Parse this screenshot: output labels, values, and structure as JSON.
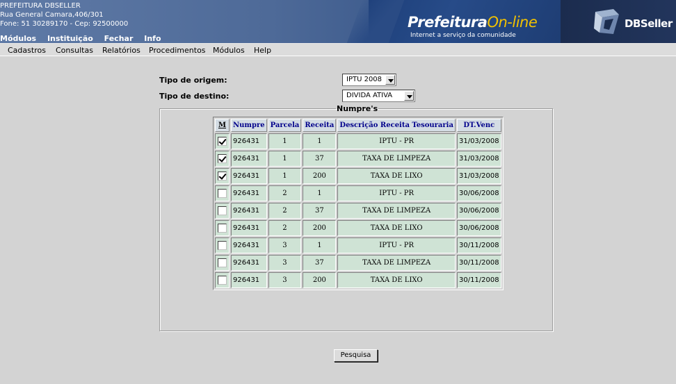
{
  "header": {
    "org_name": "PREFEITURA DBSELLER",
    "address": "Rua General Camara,406/301",
    "contact": "Fone: 51 30289170  -  Cep: 92500000",
    "top_menu": [
      "Módulos",
      "Instituição",
      "Fechar",
      "Info"
    ],
    "portal_title_main": "Prefeitura",
    "portal_title_accent": "On-line",
    "portal_subtitle": "Internet a serviço da comunidade",
    "vendor_logo": "DBSeller"
  },
  "menubar": [
    "Cadastros",
    "Consultas",
    "Relatórios",
    "Procedimentos",
    "Módulos",
    "Help"
  ],
  "form": {
    "origem_label": "Tipo de origem:",
    "origem_value": "IPTU 2008",
    "destino_label": "Tipo de destino:",
    "destino_value": "DIVIDA ATIVA",
    "fieldset_legend": "Numpre's"
  },
  "table": {
    "headers": [
      "M",
      "Numpre",
      "Parcela",
      "Receita",
      "Descrição Receita Tesouraria",
      "DT.Venc"
    ],
    "rows": [
      {
        "checked": true,
        "numpre": "926431",
        "parcela": "1",
        "receita": "1",
        "descricao": "IPTU - PR",
        "venc": "31/03/2008"
      },
      {
        "checked": true,
        "numpre": "926431",
        "parcela": "1",
        "receita": "37",
        "descricao": "TAXA DE LIMPEZA",
        "venc": "31/03/2008"
      },
      {
        "checked": true,
        "numpre": "926431",
        "parcela": "1",
        "receita": "200",
        "descricao": "TAXA DE LIXO",
        "venc": "31/03/2008"
      },
      {
        "checked": false,
        "numpre": "926431",
        "parcela": "2",
        "receita": "1",
        "descricao": "IPTU - PR",
        "venc": "30/06/2008"
      },
      {
        "checked": false,
        "numpre": "926431",
        "parcela": "2",
        "receita": "37",
        "descricao": "TAXA DE LIMPEZA",
        "venc": "30/06/2008"
      },
      {
        "checked": false,
        "numpre": "926431",
        "parcela": "2",
        "receita": "200",
        "descricao": "TAXA DE LIXO",
        "venc": "30/06/2008"
      },
      {
        "checked": false,
        "numpre": "926431",
        "parcela": "3",
        "receita": "1",
        "descricao": "IPTU - PR",
        "venc": "30/11/2008"
      },
      {
        "checked": false,
        "numpre": "926431",
        "parcela": "3",
        "receita": "37",
        "descricao": "TAXA DE LIMPEZA",
        "venc": "30/11/2008"
      },
      {
        "checked": false,
        "numpre": "926431",
        "parcela": "3",
        "receita": "200",
        "descricao": "TAXA DE LIXO",
        "venc": "30/11/2008"
      }
    ]
  },
  "buttons": {
    "search": "Pesquisa"
  },
  "colors": {
    "header_bg": "#4e6a98",
    "accent_yellow": "#f2c200",
    "table_header_bg": "#d4dde4",
    "table_header_text": "#00008b",
    "table_cell_bg": "#cfe3d5",
    "page_bg": "#d3d3d3"
  }
}
